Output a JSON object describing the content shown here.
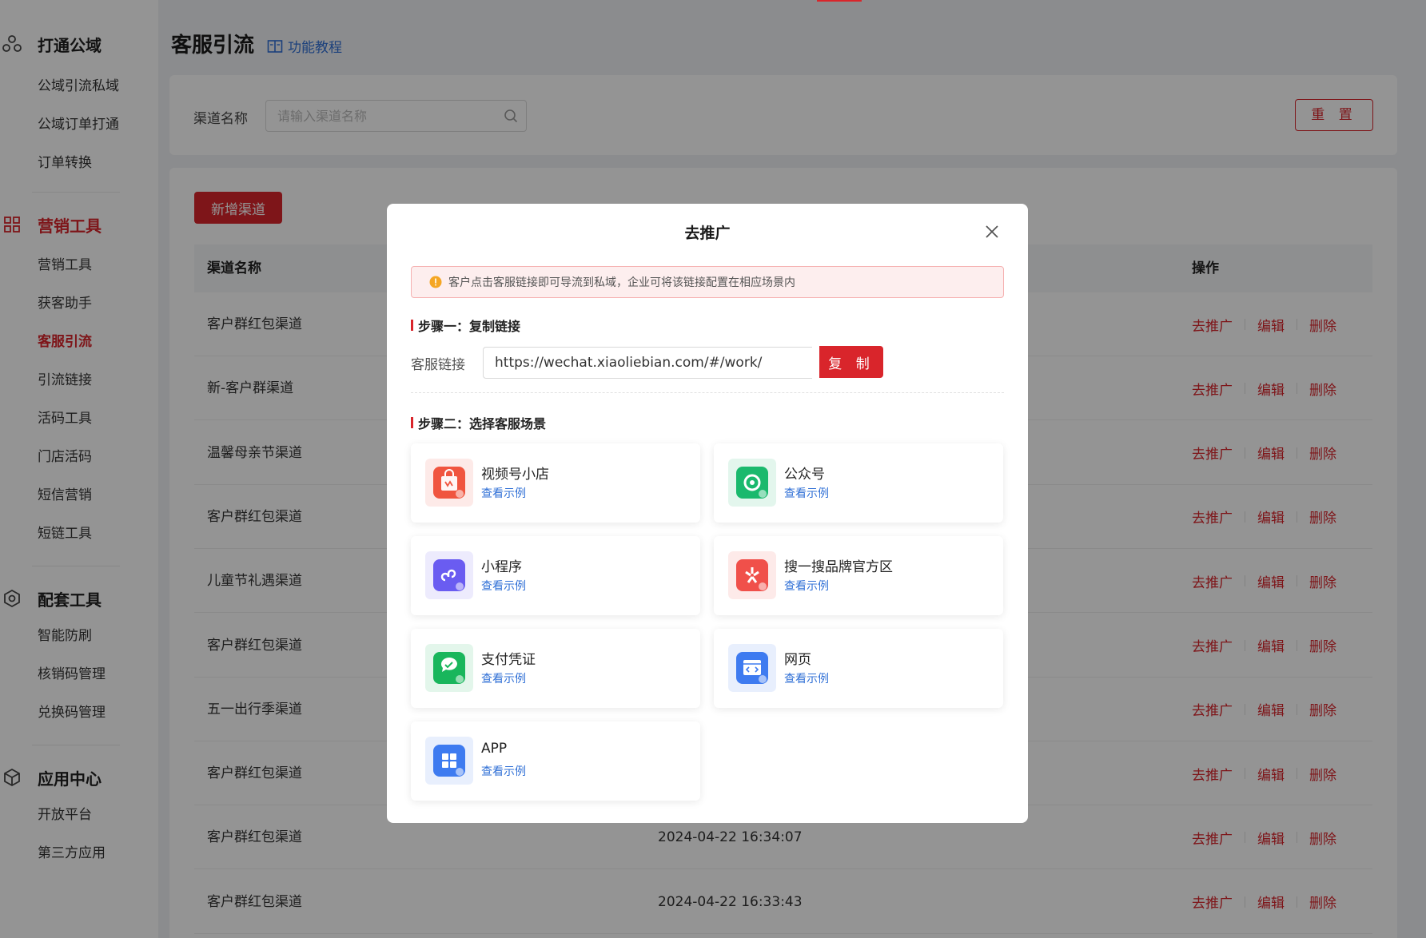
{
  "sidebar": {
    "groups": [
      {
        "title": "打通公域",
        "icon": "cloud-nodes-icon",
        "items": [
          "公域引流私域",
          "公域订单打通",
          "订单转换"
        ]
      },
      {
        "title": "营销工具",
        "icon": "grid-icon",
        "items": [
          "营销工具",
          "获客助手",
          "客服引流",
          "引流链接",
          "活码工具",
          "门店活码",
          "短信营销",
          "短链工具"
        ]
      },
      {
        "title": "配套工具",
        "icon": "hexagon-icon",
        "items": [
          "智能防刷",
          "核销码管理",
          "兑换码管理"
        ]
      },
      {
        "title": "应用中心",
        "icon": "cube-icon",
        "items": [
          "开放平台",
          "第三方应用"
        ]
      }
    ]
  },
  "header": {
    "title": "客服引流",
    "tutorial": "功能教程"
  },
  "filter": {
    "label": "渠道名称",
    "placeholder": "请输入渠道名称",
    "reset": "重 置"
  },
  "table": {
    "add_button": "新增渠道",
    "columns": {
      "name": "渠道名称",
      "ops": "操作"
    },
    "rows": [
      {
        "name": "客户群红包渠道",
        "time": ""
      },
      {
        "name": "新-客户群渠道",
        "time": ""
      },
      {
        "name": "温馨母亲节渠道",
        "time": ""
      },
      {
        "name": "客户群红包渠道",
        "time": ""
      },
      {
        "name": "儿童节礼遇渠道",
        "time": ""
      },
      {
        "name": "客户群红包渠道",
        "time": ""
      },
      {
        "name": "五一出行季渠道",
        "time": ""
      },
      {
        "name": "客户群红包渠道",
        "time": ""
      },
      {
        "name": "客户群红包渠道",
        "time": "2024-04-22 16:34:07"
      },
      {
        "name": "客户群红包渠道",
        "time": "2024-04-22 16:33:43"
      }
    ],
    "op_labels": {
      "promote": "去推广",
      "edit": "编辑",
      "delete": "删除"
    }
  },
  "modal": {
    "title": "去推广",
    "notice": "客户点击客服链接即可导流到私域，企业可将该链接配置在相应场景内",
    "step1": "步骤一：复制链接",
    "link_label": "客服链接",
    "link_value": "https://wechat.xiaoliebian.com/#/work/",
    "copy_button": "复 制",
    "step2": "步骤二：选择客服场景",
    "scenes": [
      {
        "name": "视频号小店",
        "link": "查看示例",
        "icon": "video-shop-icon",
        "color": "#f0553f"
      },
      {
        "name": "公众号",
        "link": "查看示例",
        "icon": "official-account-icon",
        "color": "#1ab96d"
      },
      {
        "name": "小程序",
        "link": "查看示例",
        "icon": "mini-program-icon",
        "color": "#6a5cf1"
      },
      {
        "name": "搜一搜品牌官方区",
        "link": "查看示例",
        "icon": "search-brand-icon",
        "color": "#f0504a"
      },
      {
        "name": "支付凭证",
        "link": "查看示例",
        "icon": "payment-voucher-icon",
        "color": "#19b65c"
      },
      {
        "name": "网页",
        "link": "查看示例",
        "icon": "webpage-icon",
        "color": "#3e7bf0"
      },
      {
        "name": "APP",
        "link": "查看示例",
        "icon": "app-icon",
        "color": "#3e7bf0"
      }
    ]
  },
  "colors": {
    "accent": "#d9252b",
    "link": "#2f6fd6"
  }
}
